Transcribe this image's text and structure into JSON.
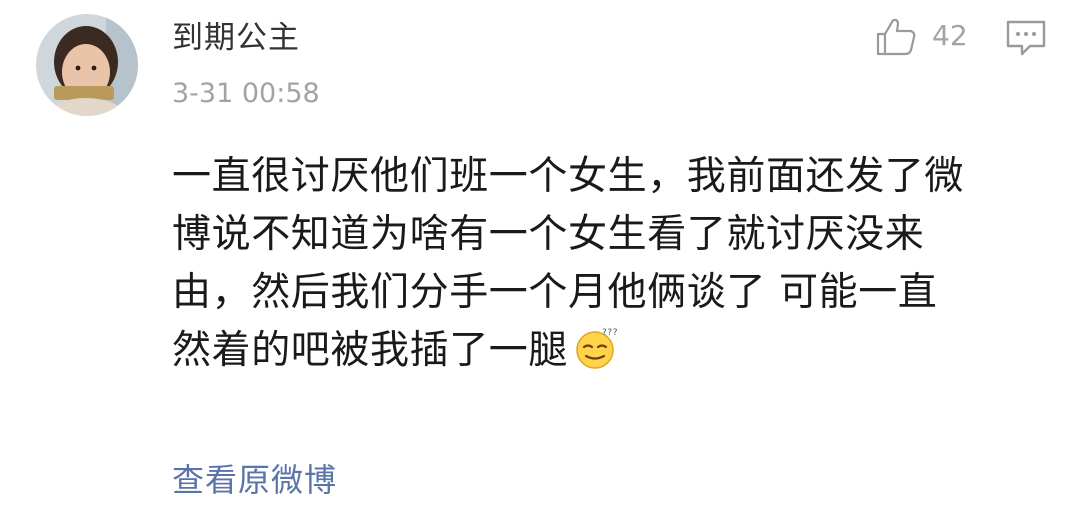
{
  "comment": {
    "username": "到期公主",
    "timestamp": "3-31 00:58",
    "like_count": "42",
    "body_lines": [
      "一直很讨厌他们班一个女生，我前面还发了微",
      "博说不知道为啥有一个女生看了就讨厌没来",
      "由，然后我们分手一个月他俩谈了 可能一直",
      "然着的吧被我插了一腿"
    ],
    "view_original_label": "查看原微博",
    "icons": {
      "like": "thumbs-up-icon",
      "reply": "comment-bubble-icon",
      "emoji": "sleepy-emoji-icon"
    },
    "colors": {
      "username": "#333333",
      "meta": "#a3a3a3",
      "body": "#1a1a1a",
      "link": "#5a73a8"
    }
  }
}
